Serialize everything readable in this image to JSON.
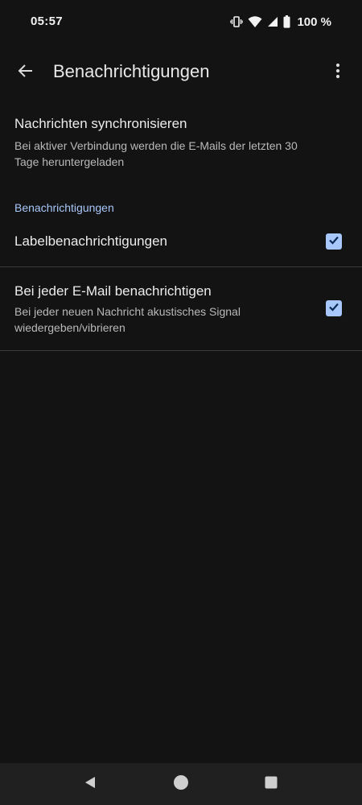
{
  "status_bar": {
    "time": "05:57",
    "battery": "100 %",
    "icons": [
      "vibrate-icon",
      "wifi-icon",
      "cellular-signal-icon",
      "battery-icon"
    ]
  },
  "app_bar": {
    "title": "Benachrichtigungen",
    "back_icon": "arrow-left-icon",
    "overflow_icon": "more-vert-icon"
  },
  "sync": {
    "title": "Nachrichten synchronisieren",
    "summary": "Bei aktiver Verbindung werden die E-Mails der letzten 30 Tage heruntergeladen"
  },
  "notifications_section": {
    "header": "Benachrichtigungen",
    "items": [
      {
        "title": "Labelbenachrichtigungen",
        "summary": "",
        "checked": true
      },
      {
        "title": "Bei jeder E-Mail benachrichtigen",
        "summary": "Bei jeder neuen Nachricht akustisches Signal wiedergeben/vibrieren",
        "checked": true
      }
    ]
  },
  "nav_bar": {
    "buttons": [
      "back-triangle-icon",
      "home-circle-icon",
      "recents-square-icon"
    ]
  },
  "colors": {
    "background": "#131313",
    "accent": "#a8c7fa",
    "divider": "#3a3a3a",
    "nav_bar": "#202020"
  }
}
